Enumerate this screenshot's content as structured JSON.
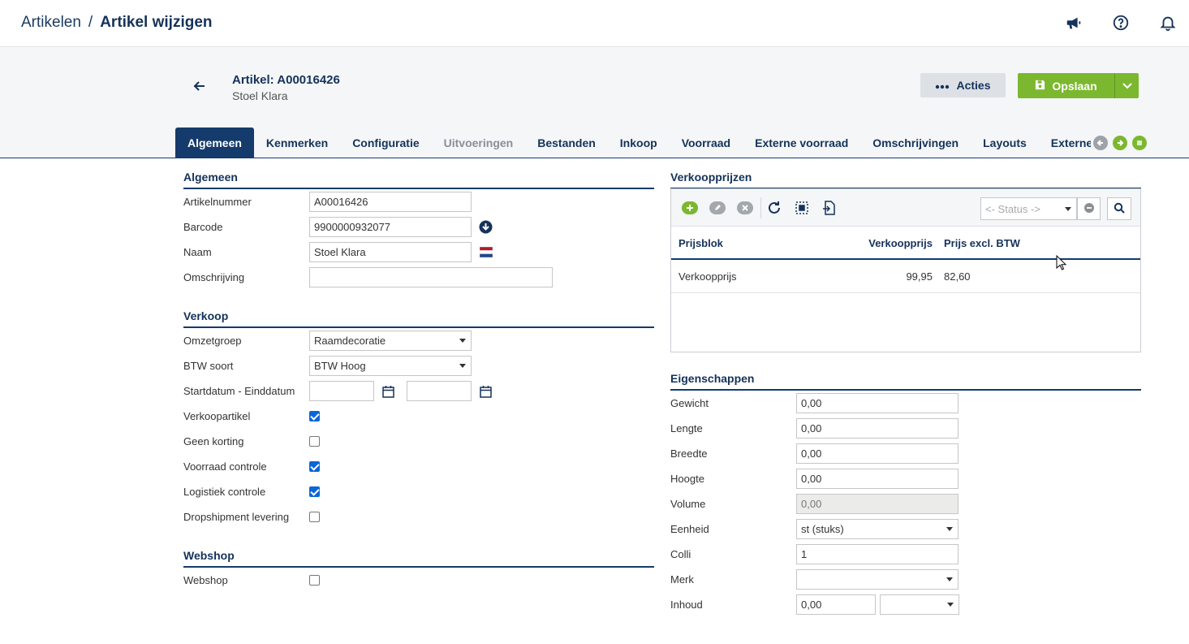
{
  "breadcrumb": {
    "parent": "Artikelen",
    "separator": "/",
    "current": "Artikel wijzigen"
  },
  "topbar_icons": [
    "megaphone-icon",
    "help-icon",
    "bell-icon"
  ],
  "header": {
    "title": "Artikel: A00016426",
    "subtitle": "Stoel Klara",
    "acties_label": "Acties",
    "opslaan_label": "Opslaan"
  },
  "tabs": [
    {
      "label": "Algemeen",
      "state": "active"
    },
    {
      "label": "Kenmerken",
      "state": "normal"
    },
    {
      "label": "Configuratie",
      "state": "normal"
    },
    {
      "label": "Uitvoeringen",
      "state": "disabled"
    },
    {
      "label": "Bestanden",
      "state": "normal"
    },
    {
      "label": "Inkoop",
      "state": "normal"
    },
    {
      "label": "Voorraad",
      "state": "normal"
    },
    {
      "label": "Externe voorraad",
      "state": "normal"
    },
    {
      "label": "Omschrijvingen",
      "state": "normal"
    },
    {
      "label": "Layouts",
      "state": "normal"
    },
    {
      "label": "Externe nummers",
      "state": "normal"
    }
  ],
  "algemeen": {
    "title": "Algemeen",
    "artikelnummer": {
      "label": "Artikelnummer",
      "value": "A00016426"
    },
    "barcode": {
      "label": "Barcode",
      "value": "9900000932077"
    },
    "naam": {
      "label": "Naam",
      "value": "Stoel Klara"
    },
    "omschrijving": {
      "label": "Omschrijving",
      "value": ""
    }
  },
  "verkoop": {
    "title": "Verkoop",
    "omzetgroep": {
      "label": "Omzetgroep",
      "value": "Raamdecoratie"
    },
    "btw_soort": {
      "label": "BTW soort",
      "value": "BTW Hoog"
    },
    "datum": {
      "label": "Startdatum - Einddatum",
      "start": "",
      "end": ""
    },
    "verkoopartikel": {
      "label": "Verkoopartikel",
      "checked": true
    },
    "geen_korting": {
      "label": "Geen korting",
      "checked": false
    },
    "voorraad_controle": {
      "label": "Voorraad controle",
      "checked": true
    },
    "logistiek_controle": {
      "label": "Logistiek controle",
      "checked": true
    },
    "dropshipment": {
      "label": "Dropshipment levering",
      "checked": false
    }
  },
  "webshop": {
    "title": "Webshop",
    "webshop": {
      "label": "Webshop",
      "checked": false
    }
  },
  "verkoopprijzen": {
    "title": "Verkoopprijzen",
    "status_placeholder": "<- Status ->",
    "columns": [
      "Prijsblok",
      "Verkoopprijs",
      "Prijs excl. BTW"
    ],
    "rows": [
      {
        "prijsblok": "Verkoopprijs",
        "verkoopprijs": "99,95",
        "excl_btw": "82,60"
      }
    ]
  },
  "eigenschappen": {
    "title": "Eigenschappen",
    "gewicht": {
      "label": "Gewicht",
      "value": "0,00"
    },
    "lengte": {
      "label": "Lengte",
      "value": "0,00"
    },
    "breedte": {
      "label": "Breedte",
      "value": "0,00"
    },
    "hoogte": {
      "label": "Hoogte",
      "value": "0,00"
    },
    "volume": {
      "label": "Volume",
      "value": "0,00"
    },
    "eenheid": {
      "label": "Eenheid",
      "value": "st (stuks)"
    },
    "colli": {
      "label": "Colli",
      "value": "1"
    },
    "merk": {
      "label": "Merk",
      "value": ""
    },
    "inhoud": {
      "label": "Inhoud",
      "value": "0,00",
      "unit": ""
    }
  },
  "colors": {
    "navy": "#143b6b",
    "green": "#7cb82f",
    "grey_button": "#dde1e5"
  }
}
